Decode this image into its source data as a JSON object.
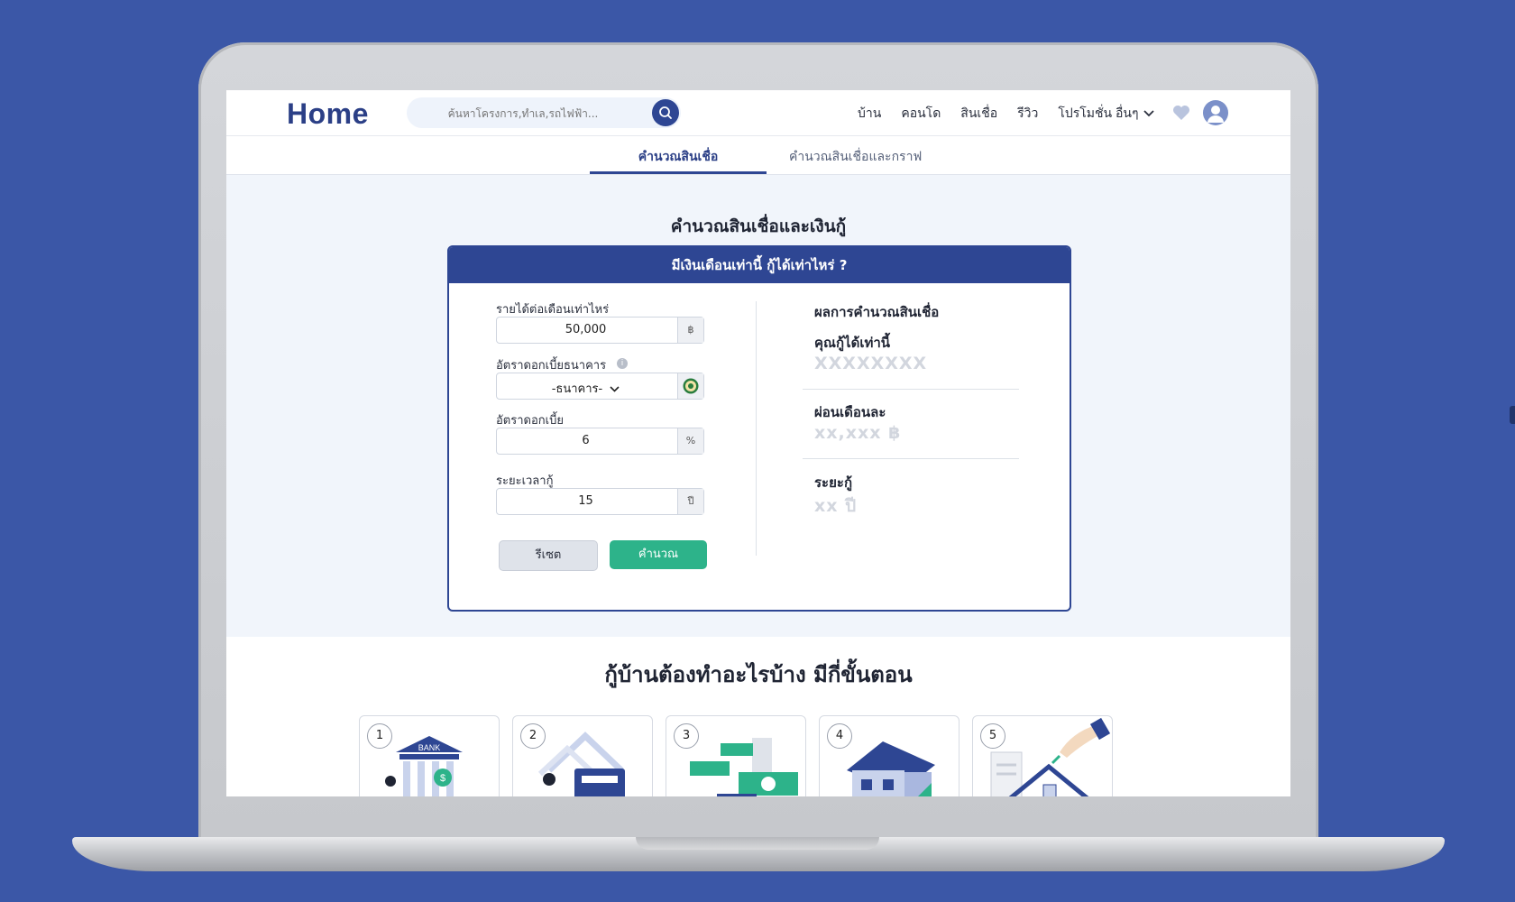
{
  "brand": {
    "logo_text": "Home",
    "primary": "#2e4693",
    "accent_green": "#2db38a",
    "background": "#3b57a7"
  },
  "search": {
    "placeholder": "ค้นหาโครงการ,ทำเล,รถไฟฟ้า..."
  },
  "nav": {
    "items": [
      "บ้าน",
      "คอนโด",
      "สินเชื่อ",
      "รีวิว",
      "โปรโมชั่น"
    ],
    "more_label": "อื่นๆ"
  },
  "tabs": {
    "active": "คำนวณสินเชื่อ",
    "inactive": "คำนวณสินเชื่อและกราฟ"
  },
  "page": {
    "title": "คำนวณสินเชื่อและเงินกู้"
  },
  "calculator": {
    "header": "มีเงินเดือนเท่านี้ กู้ได้เท่าไหร่ ?",
    "income_label": "รายได้ต่อเดือนเท่าไหร่",
    "income_value": "50,000",
    "income_unit": "฿",
    "bank_rate_label": "อัตราดอกเบี้ยธนาคาร",
    "bank_select_value": "-ธนาคาร-",
    "rate_label": "อัตราดอกเบี้ย",
    "rate_value": "6",
    "rate_unit": "%",
    "term_label": "ระยะเวลากู้",
    "term_value": "15",
    "term_unit": "ปี",
    "reset_label": "รีเซต",
    "calc_label": "คำนวณ"
  },
  "result": {
    "title": "ผลการคำนวณสินเชื่อ",
    "loan_label": "คุณกู้ได้เท่านี้",
    "loan_placeholder": "XXXXXXXX",
    "monthly_label": "ผ่อนเดือนละ",
    "monthly_placeholder": "xx,xxx ฿",
    "term_label": "ระยะกู้",
    "term_placeholder": "xx ปี"
  },
  "steps": {
    "title": "กู้บ้านต้องทำอะไรบ้าง มีกี่ขั้นตอน",
    "numbers": [
      "1",
      "2",
      "3",
      "4",
      "5"
    ],
    "bank_sign": "BANK"
  }
}
